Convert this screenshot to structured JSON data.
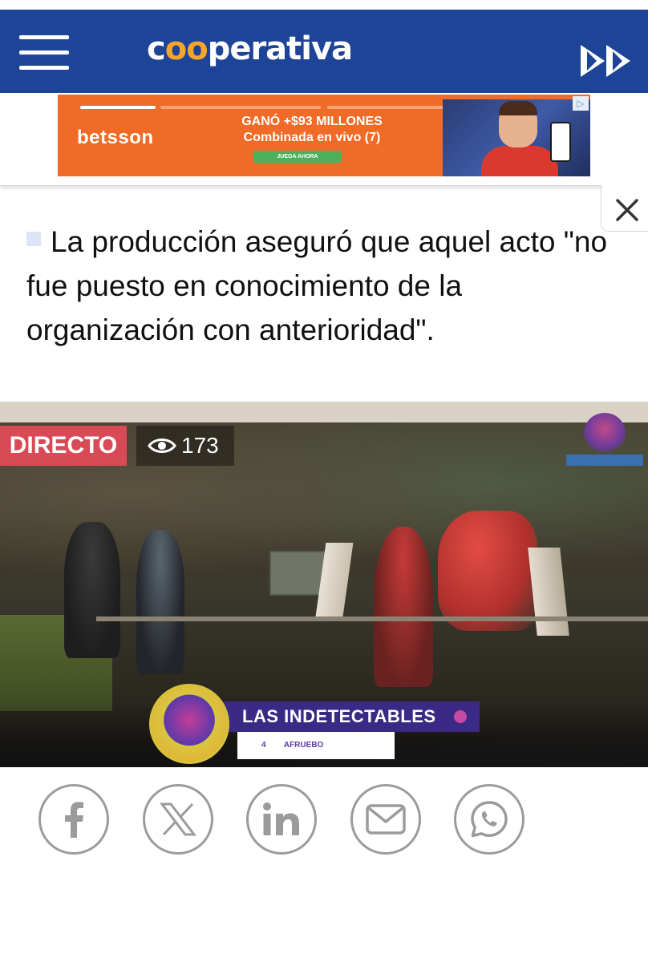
{
  "header": {
    "logo_pre": "c",
    "logo_oo": "oo",
    "logo_post": "perativa",
    "menu_icon": "hamburger-menu-icon",
    "forward_icon": "fast-forward-icon"
  },
  "ad": {
    "brand": "betsson",
    "headline_line1": "GANÓ +$93 MILLONES",
    "headline_line2": "Combinada en vivo (7)",
    "cta": "JUEGA AHORA",
    "info_icon": "ad-choices-icon",
    "background_color": "#ef6b27"
  },
  "close_icon": "close-icon",
  "article": {
    "lead": "La producción aseguró que aquel acto \"no fue puesto en conocimiento de la organización con anterioridad\"."
  },
  "video": {
    "live_label": "DIRECTO",
    "viewer_count": "173",
    "viewer_icon": "eye-icon",
    "show_name": "LAS INDETECTABLES",
    "show_sub_number": "4",
    "show_sub_brand": "AFRUEBO"
  },
  "share": {
    "buttons": [
      {
        "network": "facebook",
        "icon": "facebook-icon"
      },
      {
        "network": "x",
        "icon": "x-icon"
      },
      {
        "network": "linkedin",
        "icon": "linkedin-icon"
      },
      {
        "network": "email",
        "icon": "email-icon"
      },
      {
        "network": "whatsapp",
        "icon": "whatsapp-icon"
      }
    ],
    "icon_color": "#9b9b9b"
  },
  "colors": {
    "header_bg": "#1d4496",
    "logo_accent": "#f3a52c",
    "live_red": "#d84b56"
  }
}
